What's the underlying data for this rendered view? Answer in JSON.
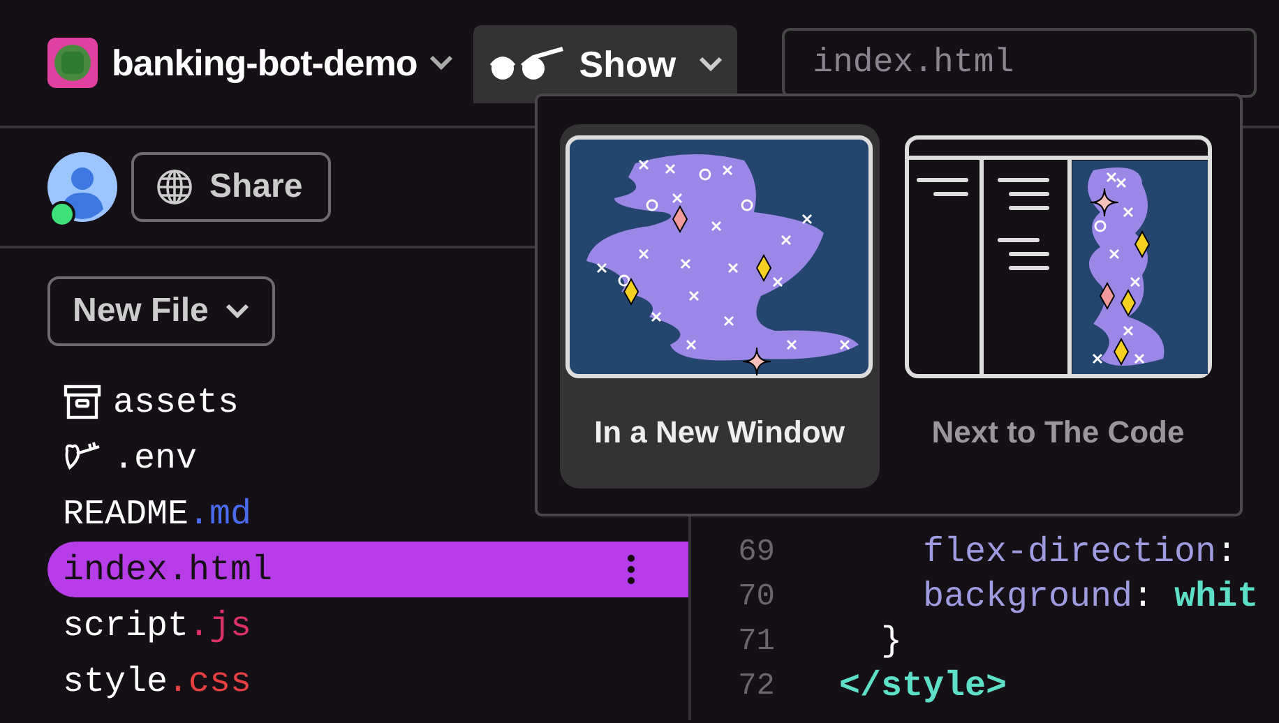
{
  "project": {
    "name": "banking-bot-demo"
  },
  "show_button": {
    "label": "Show"
  },
  "file_field": {
    "value": "index.html"
  },
  "share_button": {
    "label": "Share"
  },
  "user": {
    "online": true
  },
  "new_file_button": {
    "label": "New File"
  },
  "files": [
    {
      "kind": "folder",
      "base": "assets",
      "selected": false
    },
    {
      "kind": "env",
      "base": ".env",
      "selected": false
    },
    {
      "kind": "file",
      "base": "README",
      "ext": ".md",
      "color": "#4a6cf0",
      "selected": false
    },
    {
      "kind": "file",
      "base": "index",
      "ext": ".html",
      "color": "#151016",
      "selected": true
    },
    {
      "kind": "file",
      "base": "script",
      "ext": ".js",
      "color": "#e0306a",
      "selected": false
    },
    {
      "kind": "file",
      "base": "style",
      "ext": ".css",
      "color": "#e84040",
      "selected": false
    }
  ],
  "code_lines": [
    {
      "number": "69",
      "tokens": [
        {
          "kind": "prop",
          "text": "    flex-direction"
        },
        {
          "kind": "punct",
          "text": ":"
        }
      ]
    },
    {
      "number": "70",
      "tokens": [
        {
          "kind": "prop",
          "text": "    background"
        },
        {
          "kind": "punct",
          "text": ": "
        },
        {
          "kind": "value",
          "text": "whit"
        }
      ]
    },
    {
      "number": "71",
      "tokens": [
        {
          "kind": "punct",
          "text": "  }"
        }
      ]
    },
    {
      "number": "72",
      "tokens": [
        {
          "kind": "tag",
          "text": "</style>"
        }
      ]
    }
  ],
  "show_menu": {
    "options": [
      {
        "kind": "window",
        "label": "In a New Window",
        "selected": true
      },
      {
        "kind": "split",
        "label": "Next to The Code",
        "selected": false
      }
    ]
  }
}
